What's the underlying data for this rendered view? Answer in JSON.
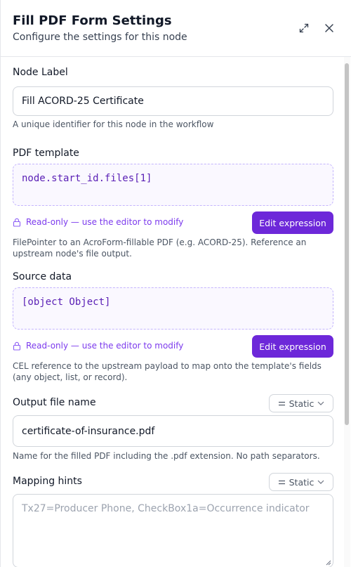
{
  "header": {
    "title": "Fill PDF Form Settings",
    "subtitle": "Configure the settings for this node",
    "expand_icon": "expand-icon",
    "close_icon": "close-icon"
  },
  "node_label": {
    "label": "Node Label",
    "value": "Fill ACORD-25 Certificate",
    "help": "A unique identifier for this node in the workflow"
  },
  "pdf_template": {
    "label": "PDF template",
    "expression": "node.start_id.files[1]",
    "readonly_text": "Read-only — use the editor to modify",
    "edit_label": "Edit expression",
    "help": "FilePointer to an AcroForm-fillable PDF (e.g. ACORD-25). Reference an upstream node's file output."
  },
  "source_data": {
    "label": "Source data",
    "expression": "[object Object]",
    "readonly_text": "Read-only — use the editor to modify",
    "edit_label": "Edit expression",
    "help": "CEL reference to the upstream payload to map onto the template's fields (any object, list, or record)."
  },
  "output_file_name": {
    "label": "Output file name",
    "mode_label": "Static",
    "value": "certificate-of-insurance.pdf",
    "help": "Name for the filled PDF including the .pdf extension. No path separators."
  },
  "mapping_hints": {
    "label": "Mapping hints",
    "mode_label": "Static",
    "placeholder": "Tx27=Producer Phone, CheckBox1a=Occurrence indicator"
  },
  "colors": {
    "accent": "#6d28d9",
    "accent_text": "#7c3aed",
    "expression_bg": "#faf8ff"
  }
}
